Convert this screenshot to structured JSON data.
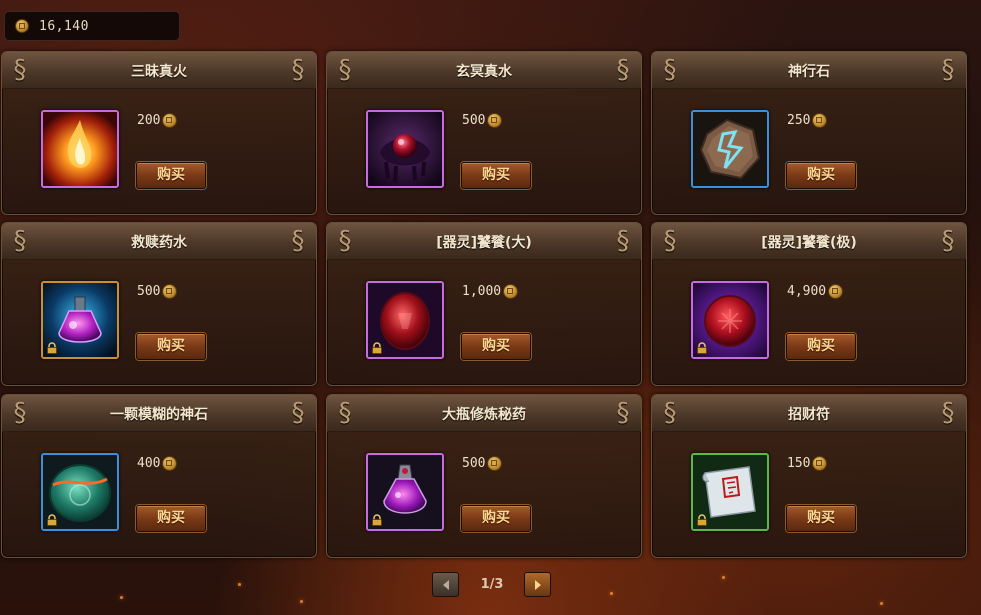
{
  "currency": {
    "icon": "coin-icon",
    "amount": "16,140"
  },
  "items": [
    {
      "name": "三昧真火",
      "price": "200",
      "buy_label": "购买",
      "icon": "flame-icon",
      "frame": "purple",
      "locked": false
    },
    {
      "name": "玄冥真水",
      "price": "500",
      "buy_label": "购买",
      "icon": "dark-water-orb-icon",
      "frame": "purple",
      "locked": false
    },
    {
      "name": "神行石",
      "price": "250",
      "buy_label": "购买",
      "icon": "rune-stone-icon",
      "frame": "blue",
      "locked": false
    },
    {
      "name": "救赎药水",
      "price": "500",
      "buy_label": "购买",
      "icon": "potion-icon",
      "frame": "gold",
      "locked": true
    },
    {
      "name": "[器灵]饕餮(大)",
      "price": "1,000",
      "buy_label": "购买",
      "icon": "red-gem-icon",
      "frame": "purple",
      "locked": true
    },
    {
      "name": "[器灵]饕餮(极)",
      "price": "4,900",
      "buy_label": "购买",
      "icon": "red-gem-icon",
      "frame": "purple",
      "locked": true
    },
    {
      "name": "一颗模糊的神石",
      "price": "400",
      "buy_label": "购买",
      "icon": "jade-stone-icon",
      "frame": "blue",
      "locked": true
    },
    {
      "name": "大瓶修炼秘药",
      "price": "500",
      "buy_label": "购买",
      "icon": "elixir-bottle-icon",
      "frame": "purple",
      "locked": true
    },
    {
      "name": "招财符",
      "price": "150",
      "buy_label": "购买",
      "icon": "scroll-icon",
      "frame": "green",
      "locked": true
    }
  ],
  "pagination": {
    "current": "1/3",
    "prev_icon": "arrow-left-icon",
    "next_icon": "arrow-right-icon"
  },
  "colors": {
    "frame_purple": "#c66be0",
    "frame_gold": "#c98f35",
    "frame_blue": "#3f8fd8",
    "frame_green": "#5fb84a",
    "buy_button": "#7a3a16"
  }
}
